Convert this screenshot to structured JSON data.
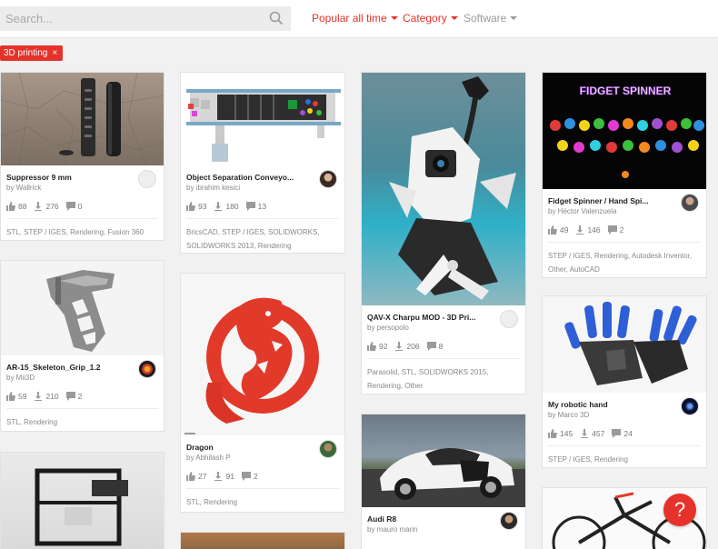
{
  "search": {
    "placeholder": "Search..."
  },
  "filters": {
    "popular": "Popular all time",
    "category": "Category",
    "software": "Software"
  },
  "active_tag": {
    "label": "3D printing",
    "remove": "×"
  },
  "colors": {
    "accent": "#e5322a",
    "muted": "#9a9a9a"
  },
  "cards": [
    {
      "title": "Suppressor 9 mm",
      "author": "by Wallrick",
      "likes": "88",
      "downloads": "276",
      "comments": "0",
      "tags": "STL, STEP / IGES, Rendering, Fusion 360"
    },
    {
      "title": "Object Separation Conveyo...",
      "author": "by ibrahim kesici",
      "likes": "93",
      "downloads": "180",
      "comments": "13",
      "tags": "BricsCAD, STEP / IGES, SOLIDWORKS, SOLIDWORKS 2013, Rendering"
    },
    {
      "title": "QAV-X Charpu MOD - 3D Pri...",
      "author": "by persopolo",
      "likes": "92",
      "downloads": "206",
      "comments": "8",
      "tags": "Parasolid, STL, SOLIDWORKS 2015, Rendering, Other"
    },
    {
      "title": "Fidget Spinner / Hand Spi...",
      "author": "by Héctor Valenzuela",
      "likes": "49",
      "downloads": "146",
      "comments": "2",
      "tags": "STEP / IGES, Rendering, Autodesk Inventor, Other, AutoCAD"
    },
    {
      "title": "AR-15_Skeleton_Grip_1.2",
      "author": "by Mii3D",
      "likes": "59",
      "downloads": "210",
      "comments": "2",
      "tags": "STL, Rendering"
    },
    {
      "title": "Dragon",
      "author": "by Abhilash P",
      "likes": "27",
      "downloads": "91",
      "comments": "2",
      "tags": "STL, Rendering"
    },
    {
      "title": "My robotic hand",
      "author": "by Marco 3D",
      "likes": "145",
      "downloads": "457",
      "comments": "24",
      "tags": "STEP / IGES, Rendering"
    },
    {
      "title": "Audi R8",
      "author": "by mauro marin"
    }
  ],
  "spinner_banner": "FIDGET SPINNER",
  "help": "?"
}
